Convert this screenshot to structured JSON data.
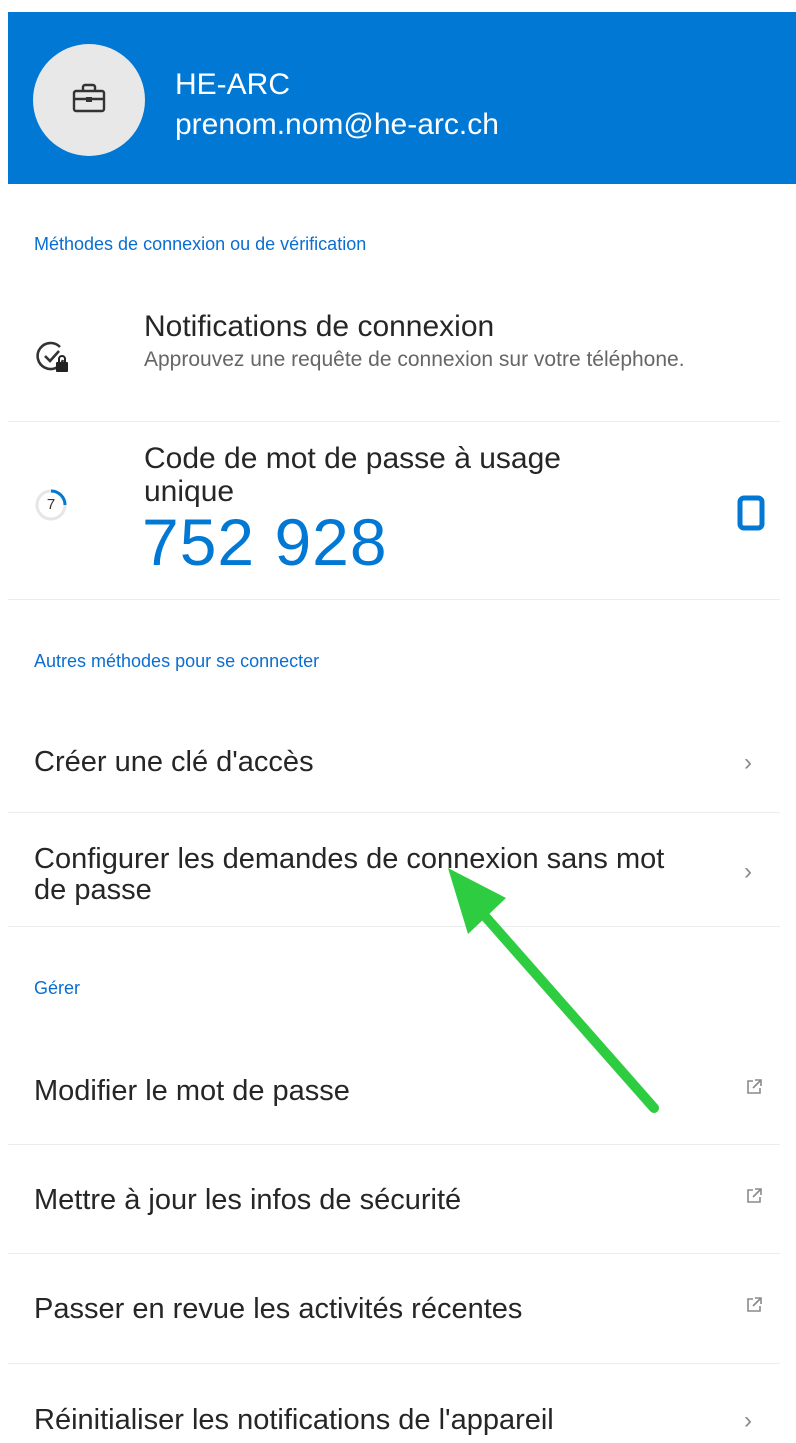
{
  "account": {
    "org": "HE-ARC",
    "email": "prenom.nom@he-arc.ch",
    "avatar_icon": "briefcase-icon"
  },
  "sections": {
    "signin_methods": "Méthodes de connexion ou de vérification",
    "other_methods": "Autres méthodes pour se connecter",
    "manage": "Gérer"
  },
  "notifications": {
    "title": "Notifications de connexion",
    "description": "Approuvez une requête de connexion sur votre téléphone.",
    "icon": "clock-check-lock-icon"
  },
  "otp": {
    "title": "Code de mot de passe à usage unique",
    "code": "752 928",
    "countdown": "7",
    "copy_icon": "copy-icon"
  },
  "other_items": [
    {
      "label": "Créer une clé d'accès",
      "icon": "chevron-right-icon"
    },
    {
      "label": "Configurer les demandes de connexion sans mot de passe",
      "icon": "chevron-right-icon"
    }
  ],
  "manage_items": [
    {
      "label": "Modifier le mot de passe",
      "icon": "external-link-icon"
    },
    {
      "label": "Mettre à jour les infos de sécurité",
      "icon": "external-link-icon"
    },
    {
      "label": "Passer en revue les activités récentes",
      "icon": "external-link-icon"
    },
    {
      "label": "Réinitialiser les notifications de l'appareil",
      "icon": "chevron-right-icon"
    }
  ],
  "colors": {
    "header": "#0078d4",
    "accent": "#0078d4",
    "annotation_arrow": "#2ecc40"
  }
}
